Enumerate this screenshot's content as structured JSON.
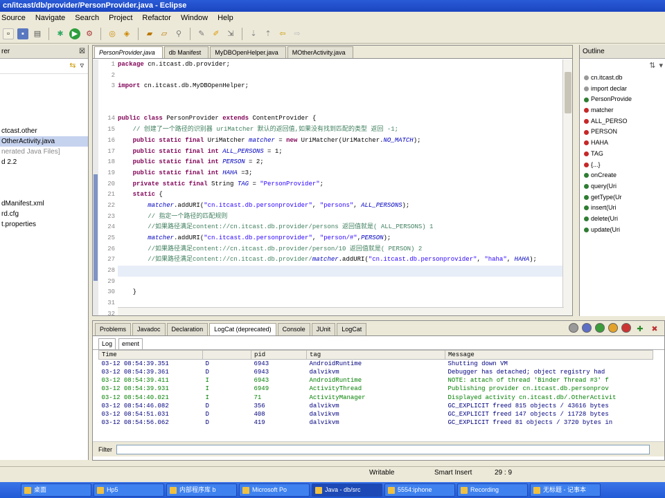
{
  "window": {
    "title": "cn/itcast/db/provider/PersonProvider.java - Eclipse"
  },
  "menu": [
    "Source",
    "Navigate",
    "Search",
    "Project",
    "Refactor",
    "Window",
    "Help"
  ],
  "left": {
    "title": "rer",
    "items": [
      {
        "label": "",
        "sel": false,
        "gray": false
      },
      {
        "label": "",
        "sel": false,
        "gray": false
      },
      {
        "label": "",
        "sel": false,
        "gray": false
      },
      {
        "label": "",
        "sel": false,
        "gray": false
      },
      {
        "label": "",
        "sel": false,
        "gray": false
      },
      {
        "label": "ctcast.other",
        "sel": false,
        "gray": false
      },
      {
        "label": "OtherActivity.java",
        "sel": true,
        "gray": false
      },
      {
        "label": "nerated Java Files]",
        "sel": false,
        "gray": true
      },
      {
        "label": "d 2.2",
        "sel": false,
        "gray": false
      },
      {
        "label": "",
        "sel": false,
        "gray": false
      },
      {
        "label": "",
        "sel": false,
        "gray": false
      },
      {
        "label": "",
        "sel": false,
        "gray": false
      },
      {
        "label": "dManifest.xml",
        "sel": false,
        "gray": false
      },
      {
        "label": "rd.cfg",
        "sel": false,
        "gray": false
      },
      {
        "label": "t.properties",
        "sel": false,
        "gray": false
      }
    ]
  },
  "editor": {
    "tabs": [
      {
        "label": "PersonProvider.java",
        "active": true
      },
      {
        "label": "db Manifest",
        "active": false
      },
      {
        "label": "MyDBOpenHelper.java",
        "active": false
      },
      {
        "label": "MOtherActivity.java",
        "active": false
      }
    ],
    "line_numbers": [
      "1",
      "2",
      "3",
      "",
      "",
      "14",
      "15",
      "16",
      "17",
      "18",
      "19",
      "20",
      "21",
      "22",
      "23",
      "24",
      "25",
      "26",
      "27",
      "28",
      "29",
      "30",
      "31",
      "32"
    ],
    "lines": [
      {
        "parts": [
          {
            "c": "kw",
            "t": "package "
          },
          {
            "c": "",
            "t": "cn.itcast.db.provider;"
          }
        ]
      },
      {
        "parts": []
      },
      {
        "parts": [
          {
            "c": "kw",
            "t": "import "
          },
          {
            "c": "",
            "t": "cn.itcast.db.MyDBOpenHelper;"
          }
        ]
      },
      {
        "parts": []
      },
      {
        "parts": []
      },
      {
        "parts": [
          {
            "c": "kw",
            "t": "public class "
          },
          {
            "c": "",
            "t": "PersonProvider "
          },
          {
            "c": "kw",
            "t": "extends "
          },
          {
            "c": "",
            "t": "ContentProvider {"
          }
        ]
      },
      {
        "parts": [
          {
            "c": "cm",
            "t": "    // 创建了一个路径的识别器 uriMatcher 默认的返回值,如果没有找到匹配的类型 返回 -1;"
          }
        ]
      },
      {
        "parts": [
          {
            "c": "kw",
            "t": "    public static final "
          },
          {
            "c": "",
            "t": "UriMatcher "
          },
          {
            "c": "fd",
            "t": "matcher"
          },
          {
            "c": "",
            "t": " = "
          },
          {
            "c": "kw",
            "t": "new "
          },
          {
            "c": "",
            "t": "UriMatcher(UriMatcher."
          },
          {
            "c": "fd",
            "t": "NO_MATCH"
          },
          {
            "c": "",
            "t": ");"
          }
        ]
      },
      {
        "parts": [
          {
            "c": "kw",
            "t": "    public static final int "
          },
          {
            "c": "fd",
            "t": "ALL_PERSONS"
          },
          {
            "c": "",
            "t": " = 1;"
          }
        ]
      },
      {
        "parts": [
          {
            "c": "kw",
            "t": "    public static final int "
          },
          {
            "c": "fd",
            "t": "PERSON"
          },
          {
            "c": "",
            "t": " = 2;"
          }
        ]
      },
      {
        "parts": [
          {
            "c": "kw",
            "t": "    public static final int "
          },
          {
            "c": "fd",
            "t": "HAHA"
          },
          {
            "c": "",
            "t": " =3;"
          }
        ]
      },
      {
        "parts": [
          {
            "c": "kw",
            "t": "    private static final "
          },
          {
            "c": "",
            "t": "String "
          },
          {
            "c": "fd",
            "t": "TAG"
          },
          {
            "c": "",
            "t": " = "
          },
          {
            "c": "st",
            "t": "\"PersonProvider\""
          },
          {
            "c": "",
            "t": ";"
          }
        ]
      },
      {
        "parts": [
          {
            "c": "kw",
            "t": "    static "
          },
          {
            "c": "",
            "t": "{"
          }
        ]
      },
      {
        "parts": [
          {
            "c": "fd",
            "t": "        matcher"
          },
          {
            "c": "",
            "t": ".addURI("
          },
          {
            "c": "st",
            "t": "\"cn.itcast.db.personprovider\""
          },
          {
            "c": "",
            "t": ", "
          },
          {
            "c": "st",
            "t": "\"persons\""
          },
          {
            "c": "",
            "t": ", "
          },
          {
            "c": "fd",
            "t": "ALL_PERSONS"
          },
          {
            "c": "",
            "t": ");"
          }
        ]
      },
      {
        "parts": [
          {
            "c": "cm",
            "t": "        // 指定一个路径的匹配规则"
          }
        ]
      },
      {
        "parts": [
          {
            "c": "cm",
            "t": "        //如果路径满足content://cn.itcast.db.provider/persons 返回值就是( ALL_PERSONS) 1"
          }
        ]
      },
      {
        "parts": [
          {
            "c": "fd",
            "t": "        matcher"
          },
          {
            "c": "",
            "t": ".addURI("
          },
          {
            "c": "st",
            "t": "\"cn.itcast.db.personprovider\""
          },
          {
            "c": "",
            "t": ", "
          },
          {
            "c": "st",
            "t": "\"person/#\""
          },
          {
            "c": "",
            "t": ","
          },
          {
            "c": "fd",
            "t": "PERSON"
          },
          {
            "c": "",
            "t": ");"
          }
        ]
      },
      {
        "parts": [
          {
            "c": "cm",
            "t": "        //如果路径满足content://cn.itcast.db.provider/person/10 返回值就是( PERSON) 2"
          }
        ]
      },
      {
        "parts": [
          {
            "c": "cm",
            "t": "        //如果路径满足content://cn.itcast.db.provider/"
          },
          {
            "c": "fd",
            "t": "matcher"
          },
          {
            "c": "",
            "t": ".addURI("
          },
          {
            "c": "st",
            "t": "\"cn.itcast.db.personprovider\""
          },
          {
            "c": "",
            "t": ", "
          },
          {
            "c": "st",
            "t": "\"haha\""
          },
          {
            "c": "",
            "t": ", "
          },
          {
            "c": "fd",
            "t": "HAHA"
          },
          {
            "c": "",
            "t": ");"
          }
        ]
      },
      {
        "parts": [],
        "hl": true
      },
      {
        "parts": []
      },
      {
        "parts": [
          {
            "c": "",
            "t": "    }"
          }
        ]
      },
      {
        "parts": []
      },
      {
        "parts": []
      }
    ]
  },
  "outline": {
    "title": "Outline",
    "items": [
      {
        "label": "cn.itcast.db",
        "color": "#999999"
      },
      {
        "label": "import declar",
        "color": "#999999"
      },
      {
        "label": "PersonProvide",
        "color": "#2e7d32"
      },
      {
        "label": "matcher",
        "color": "#c62828"
      },
      {
        "label": "ALL_PERSO",
        "color": "#c62828"
      },
      {
        "label": "PERSON",
        "color": "#c62828"
      },
      {
        "label": "HAHA",
        "color": "#c62828"
      },
      {
        "label": "TAG",
        "color": "#c62828"
      },
      {
        "label": "{...}",
        "color": "#c62828"
      },
      {
        "label": "onCreate",
        "color": "#2e7d32"
      },
      {
        "label": "query(Uri",
        "color": "#2e7d32"
      },
      {
        "label": "getType(Ur",
        "color": "#2e7d32"
      },
      {
        "label": "insert(Uri",
        "color": "#2e7d32"
      },
      {
        "label": "delete(Uri",
        "color": "#2e7d32"
      },
      {
        "label": "update(Uri",
        "color": "#2e7d32"
      }
    ]
  },
  "bottom": {
    "tabs": [
      {
        "label": "Problems",
        "active": false
      },
      {
        "label": "Javadoc",
        "active": false
      },
      {
        "label": "Declaration",
        "active": false
      },
      {
        "label": "LogCat (deprecated)",
        "active": true
      },
      {
        "label": "Console",
        "active": false
      },
      {
        "label": "JUnit",
        "active": false
      },
      {
        "label": "LogCat",
        "active": false
      }
    ],
    "subtabs": [
      "Log",
      "ement"
    ],
    "columns": [
      "Time",
      "",
      "pid",
      "tag",
      "Message"
    ],
    "rows": [
      {
        "time": "03-12 08:54:39.351",
        "lvl": "D",
        "pid": "6943",
        "tag": "AndroidRuntime",
        "msg": "Shutting down VM"
      },
      {
        "time": "03-12 08:54:39.361",
        "lvl": "D",
        "pid": "6943",
        "tag": "dalvikvm",
        "msg": "Debugger has detached; object registry had"
      },
      {
        "time": "03-12 08:54:39.411",
        "lvl": "I",
        "pid": "6943",
        "tag": "AndroidRuntime",
        "msg": "NOTE: attach of thread 'Binder Thread #3' f"
      },
      {
        "time": "03-12 08:54:39.931",
        "lvl": "I",
        "pid": "6949",
        "tag": "ActivityThread",
        "msg": "Publishing provider cn.itcast.db.personprov"
      },
      {
        "time": "03-12 08:54:40.021",
        "lvl": "I",
        "pid": "71",
        "tag": "ActivityManager",
        "msg": "Displayed activity cn.itcast.db/.OtherActivit"
      },
      {
        "time": "03-12 08:54:46.082",
        "lvl": "D",
        "pid": "356",
        "tag": "dalvikvm",
        "msg": "GC_EXPLICIT freed 815 objects / 43616 bytes"
      },
      {
        "time": "03-12 08:54:51.031",
        "lvl": "D",
        "pid": "408",
        "tag": "dalvikvm",
        "msg": "GC_EXPLICIT freed 147 objects / 11728 bytes"
      },
      {
        "time": "03-12 08:54:56.062",
        "lvl": "D",
        "pid": "419",
        "tag": "dalvikvm",
        "msg": "GC_EXPLICIT freed 81 objects / 3720 bytes in"
      }
    ],
    "filter_label": "Filter",
    "filter_value": ""
  },
  "status": {
    "writable": "Writable",
    "insert": "Smart Insert",
    "position": "29 : 9"
  },
  "taskbar": [
    "桌面",
    "Hp5",
    "内部程序库 b",
    "Microsoft Po",
    "Java - db/src",
    "5554:iphone",
    "Recording",
    "无标题 - 记事本"
  ]
}
